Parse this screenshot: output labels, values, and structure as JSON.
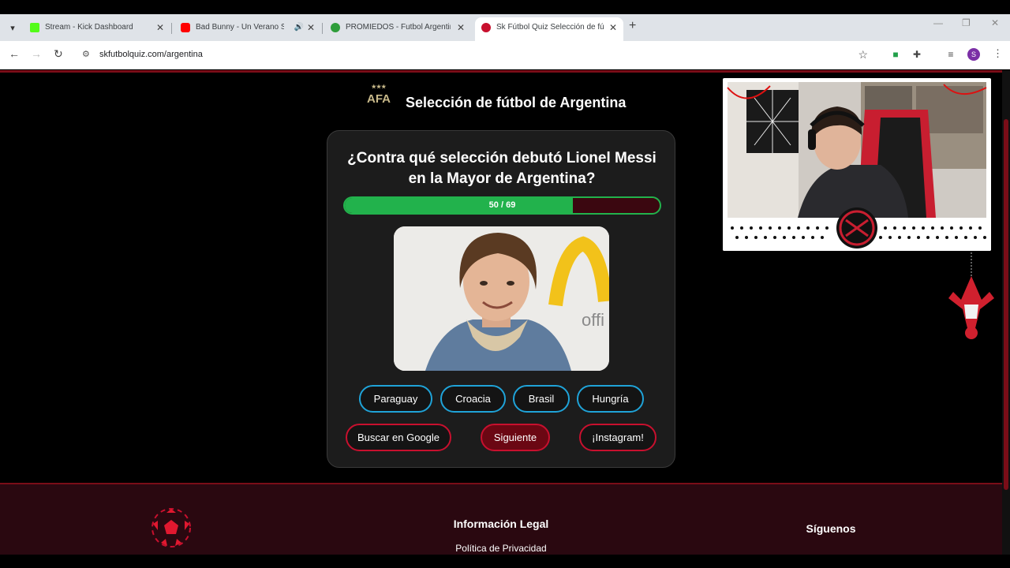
{
  "browser": {
    "tabs": [
      {
        "title": "Stream - Kick Dashboard",
        "favicon": "kick-icon",
        "color": "#53fc18"
      },
      {
        "title": "Bad Bunny - Un Verano Sin",
        "favicon": "youtube-icon",
        "color": "#ff0000"
      },
      {
        "title": "PROMIEDOS - Futbol Argentino",
        "favicon": "promiedos-icon",
        "color": "#2e9d3a"
      },
      {
        "title": "Sk Fútbol Quiz Selección de fút",
        "favicon": "ball-icon",
        "color": "#c8102e"
      }
    ],
    "url": "skfutbolquiz.com/argentina",
    "profile_initial": "S"
  },
  "header": {
    "logo_text": "AFA",
    "title": "Selección de fútbol de Argentina"
  },
  "quiz": {
    "question": "¿Contra qué selección debutó Lionel Messi en la Mayor de Argentina?",
    "progress_label": "50 / 69",
    "progress_current": 50,
    "progress_total": 69,
    "options": [
      "Paraguay",
      "Croacia",
      "Brasil",
      "Hungría"
    ],
    "actions": {
      "search": "Buscar en Google",
      "next": "Siguiente",
      "instagram": "¡Instagram!"
    },
    "photo_caption_text": "offi"
  },
  "footer": {
    "legal_title": "Información Legal",
    "privacy": "Política de Privacidad",
    "follow": "Síguenos"
  },
  "colors": {
    "accent": "#c8102e",
    "progress": "#22b24c",
    "option_border": "#1fa3d8",
    "footer_bg": "#2a0810"
  }
}
